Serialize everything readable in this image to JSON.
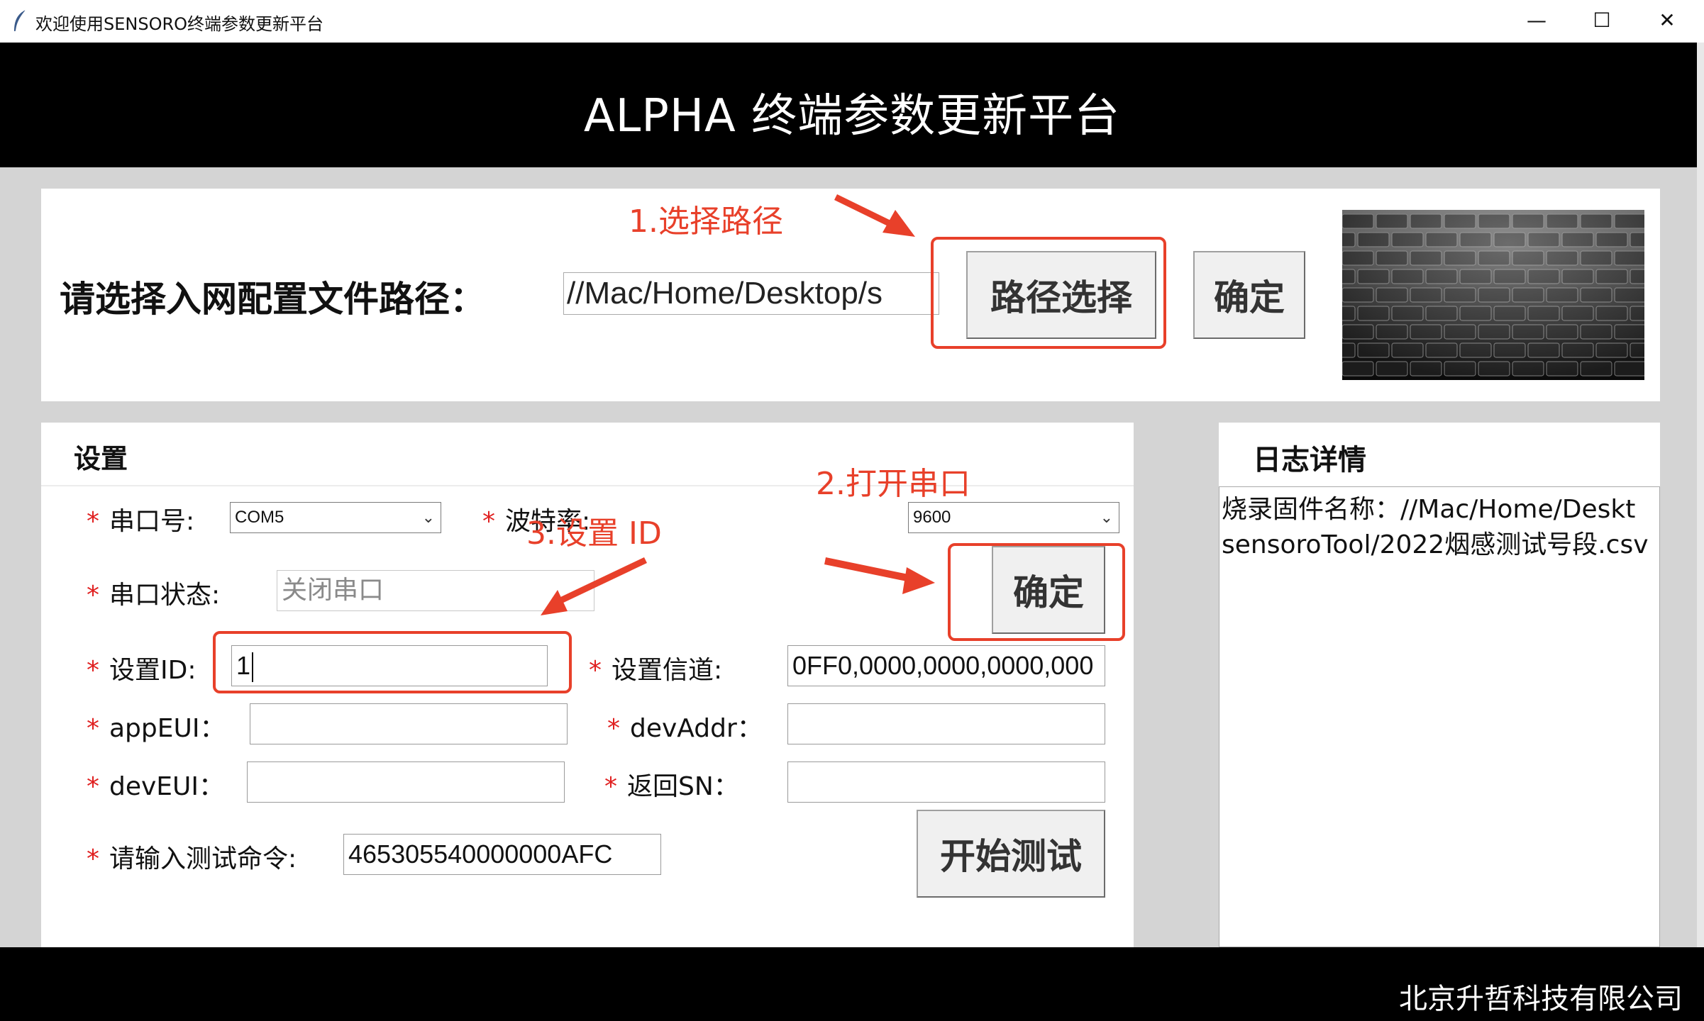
{
  "window": {
    "title": "欢迎使用SENSORO终端参数更新平台",
    "minimize": "—",
    "maximize": "☐",
    "close": "✕"
  },
  "banner": {
    "heading": "ALPHA 终端参数更新平台"
  },
  "path_section": {
    "label": "请选择入网配置文件路径：",
    "path_value": "//Mac/Home/Desktop/s",
    "select_button": "路径选择",
    "confirm_button": "确定"
  },
  "settings": {
    "title": "设置",
    "required_mark": "*",
    "serial_port_label": "串口号:",
    "serial_port_value": "COM5",
    "baud_label": "波特率:",
    "baud_value": "9600",
    "serial_status_label": "串口状态:",
    "serial_status_value": "关闭串口",
    "confirm_button": "确定",
    "set_id_label": "设置ID:",
    "set_id_value": "1",
    "set_channel_label": "设置信道:",
    "set_channel_value": "0FF0,0000,0000,0000,000",
    "app_eui_label": "appEUI：",
    "app_eui_value": "",
    "dev_addr_label": "devAddr：",
    "dev_addr_value": "",
    "dev_eui_label": "devEUI：",
    "dev_eui_value": "",
    "return_sn_label": "返回SN：",
    "return_sn_value": "",
    "test_cmd_label": "请输入测试命令:",
    "test_cmd_value": "465305540000000AFC",
    "start_test_button": "开始测试"
  },
  "log": {
    "title": "日志详情",
    "line1": "烧录固件名称：//Mac/Home/Deskt",
    "line2": "sensoroTool/2022烟感测试号段.csv"
  },
  "footer": {
    "company": "北京升哲科技有限公司"
  },
  "annotations": {
    "step1": "1.选择路径",
    "step2": "2.打开串口",
    "step3": "3.设置 ID",
    "color": "#e8402a"
  },
  "icons": {
    "app": "feather-icon",
    "dropdown": "chevron-down-icon"
  }
}
